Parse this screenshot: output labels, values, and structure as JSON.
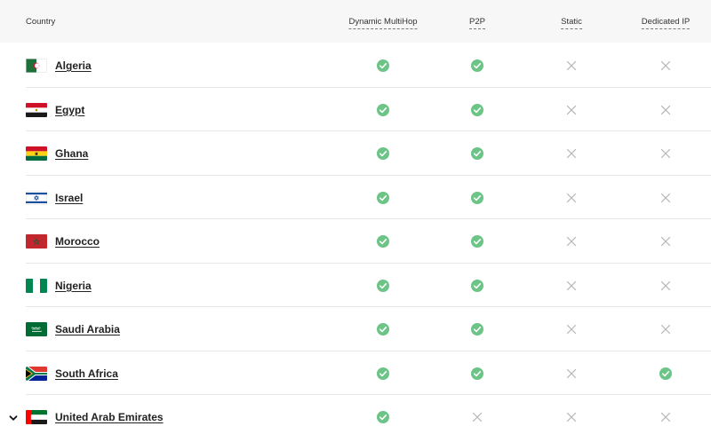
{
  "header": {
    "country": "Country",
    "col1": "Dynamic MultiHop",
    "col2": "P2P",
    "col3": "Static",
    "col4": "Dedicated IP"
  },
  "colors": {
    "check": "#6cc487",
    "cross": "#b3b3b3",
    "header_bg": "#f7f7f7",
    "divider": "#e6e6e6"
  },
  "rows": [
    {
      "country": "Algeria",
      "flag": "algeria-flag",
      "features": [
        true,
        true,
        false,
        false
      ]
    },
    {
      "country": "Egypt",
      "flag": "egypt-flag",
      "features": [
        true,
        true,
        false,
        false
      ]
    },
    {
      "country": "Ghana",
      "flag": "ghana-flag",
      "features": [
        true,
        true,
        false,
        false
      ]
    },
    {
      "country": "Israel",
      "flag": "israel-flag",
      "features": [
        true,
        true,
        false,
        false
      ]
    },
    {
      "country": "Morocco",
      "flag": "morocco-flag",
      "features": [
        true,
        true,
        false,
        false
      ]
    },
    {
      "country": "Nigeria",
      "flag": "nigeria-flag",
      "features": [
        true,
        true,
        false,
        false
      ]
    },
    {
      "country": "Saudi Arabia",
      "flag": "saudi-arabia-flag",
      "features": [
        true,
        true,
        false,
        false
      ]
    },
    {
      "country": "South Africa",
      "flag": "south-africa-flag",
      "features": [
        true,
        true,
        false,
        true
      ]
    },
    {
      "country": "United Arab Emirates",
      "flag": "uae-flag",
      "features": [
        true,
        false,
        false,
        false
      ],
      "expandable": true
    }
  ]
}
